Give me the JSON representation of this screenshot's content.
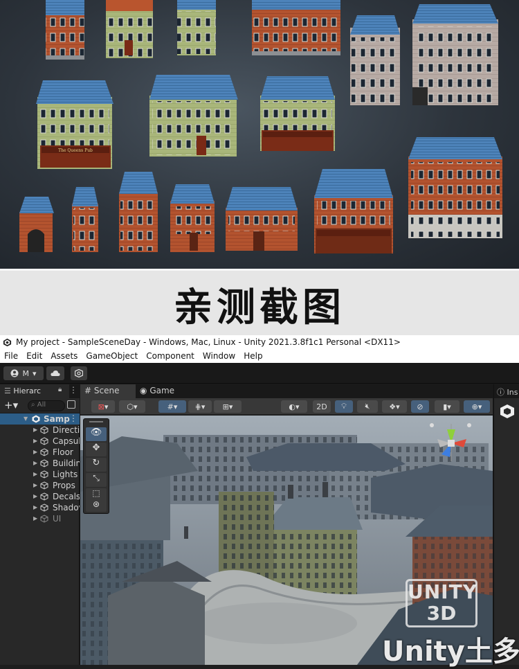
{
  "banner": {
    "text": "亲测截图"
  },
  "window": {
    "title": "My project - SampleSceneDay - Windows, Mac, Linux - Unity 2021.3.8f1c1 Personal <DX11>"
  },
  "menu": [
    "File",
    "Edit",
    "Assets",
    "GameObject",
    "Component",
    "Window",
    "Help"
  ],
  "toolbar": {
    "account_label": "M"
  },
  "hierarchy": {
    "tab_label": "Hierarc",
    "search_placeholder": "All",
    "root": "Samp",
    "items": [
      "Directi",
      "Capsul",
      "Floor",
      "Buildin",
      "Lights",
      "Props",
      "Decals",
      "Shadov",
      "UI"
    ]
  },
  "scene": {
    "tabs": [
      "Scene",
      "Game"
    ],
    "btn_2d": "2D"
  },
  "inspector": {
    "tab_label": "Ins"
  },
  "watermark": {
    "line1": "UNITY",
    "line2": "3D",
    "brand": "Unity土多"
  },
  "colors": {
    "selection": "#2c5d87",
    "accent": "#46607c",
    "roof_blue": "#4f86bd",
    "brick": "#b9552e",
    "olive": "#a8b575"
  }
}
